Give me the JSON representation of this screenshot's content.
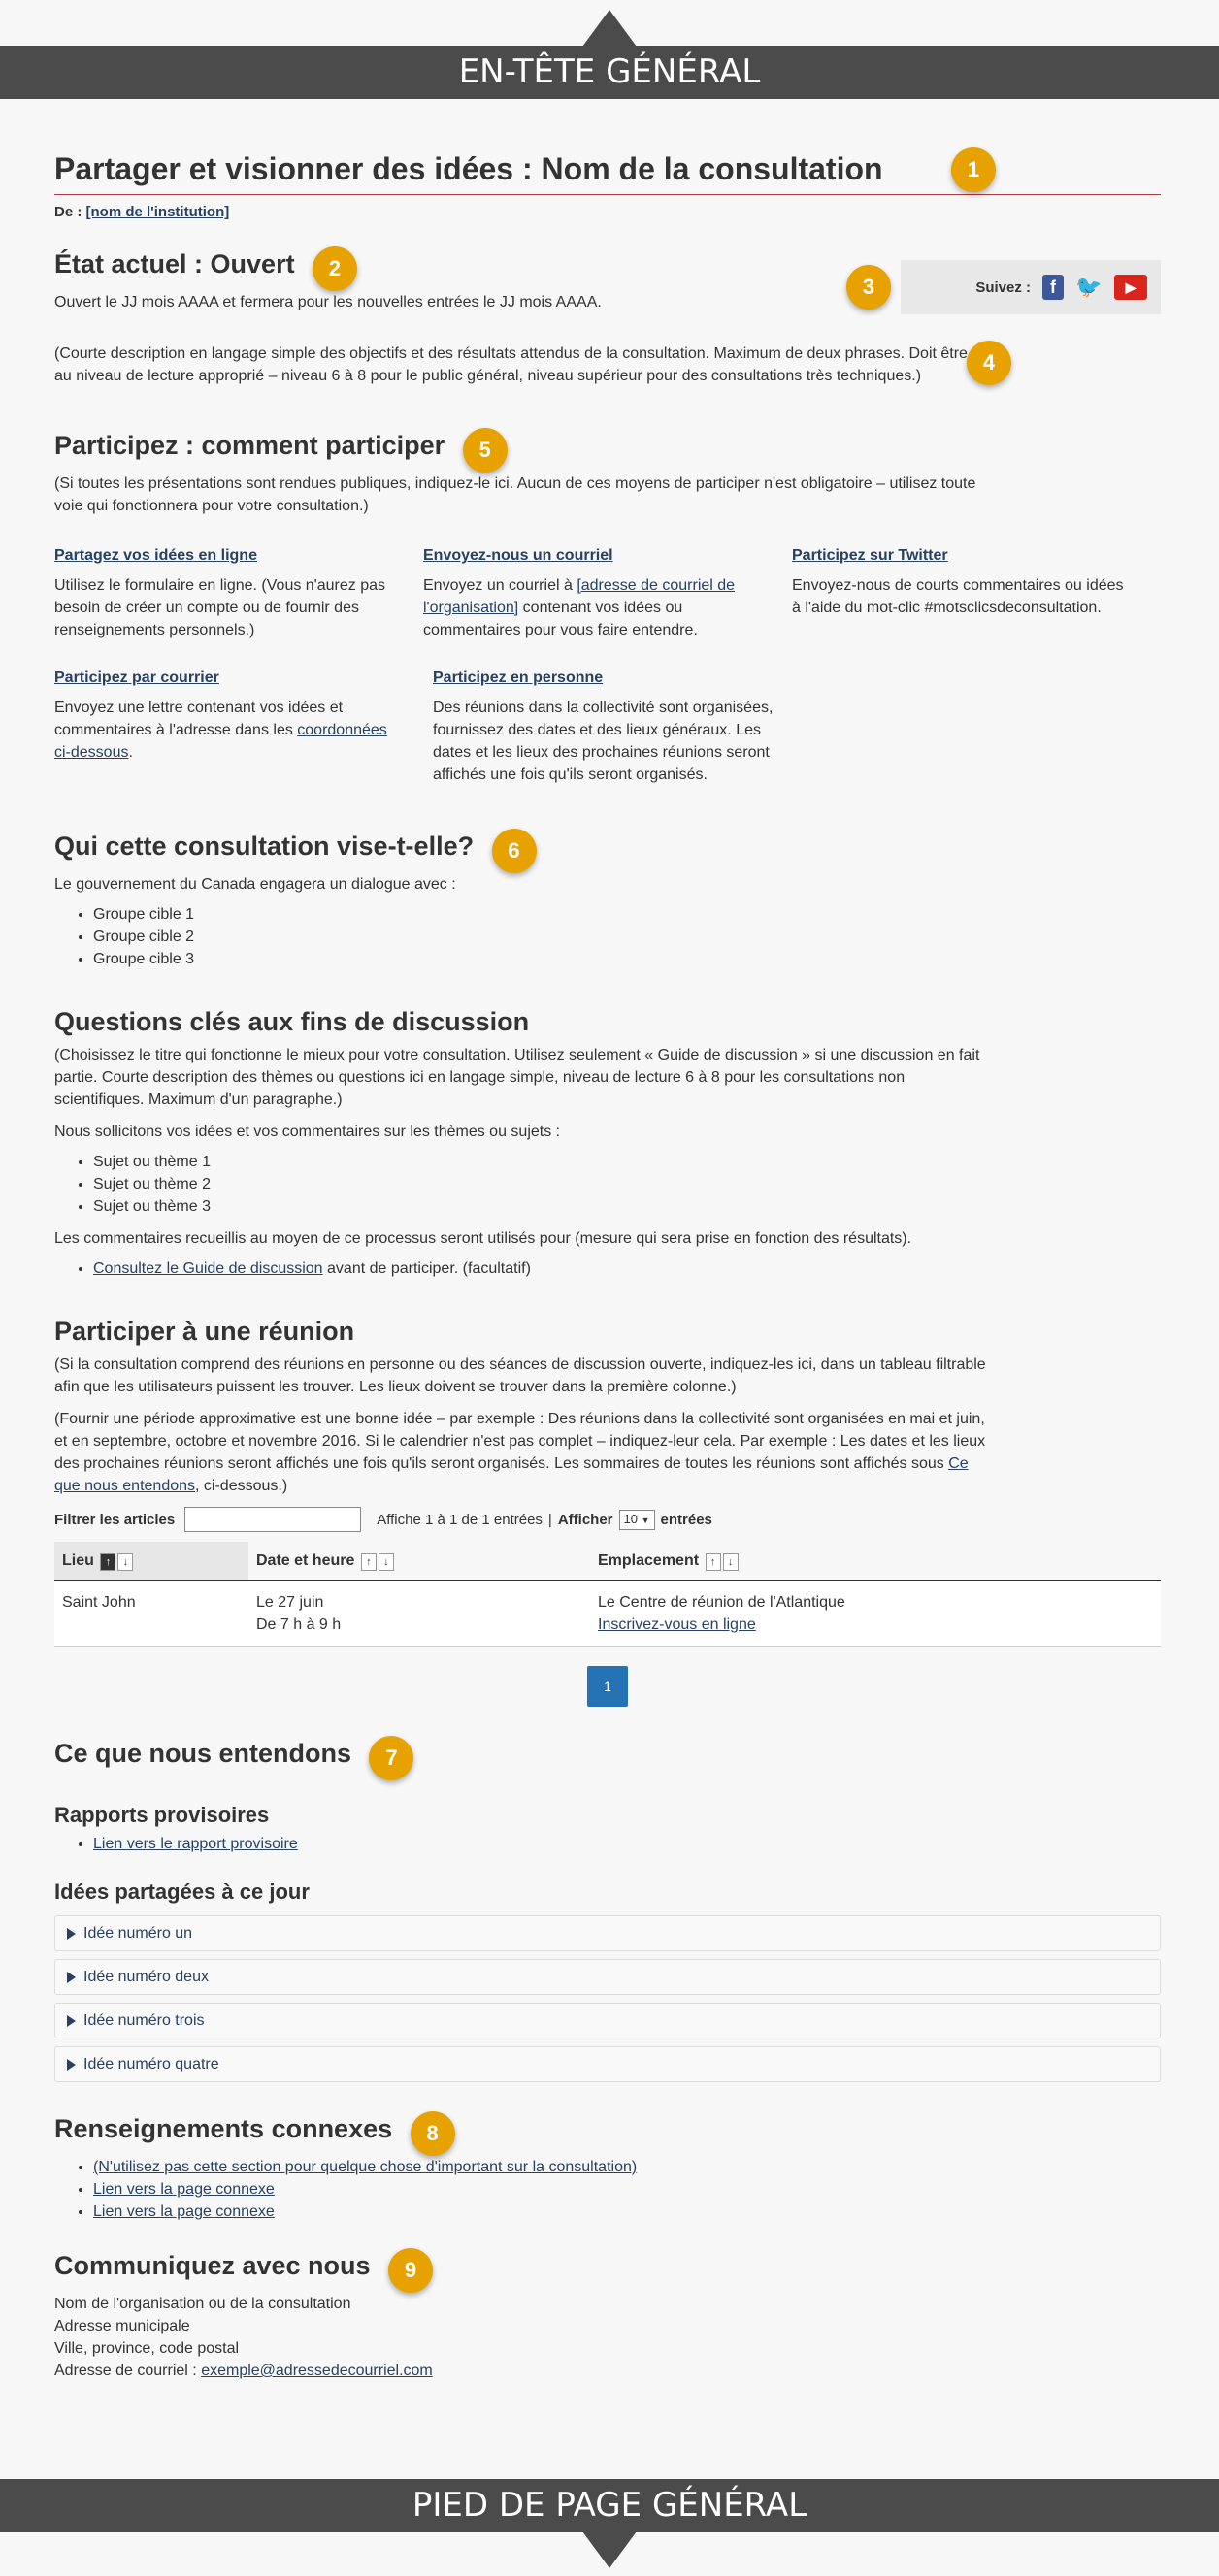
{
  "header_band": "EN-TÊTE GÉNÉRAL",
  "footer_band": "PIED DE PAGE GÉNÉRAL",
  "title": "Partager et visionner des idées : Nom de la consultation",
  "byline_prefix": "De : ",
  "byline_link": "[nom de l'institution]",
  "status": {
    "heading": "État actuel : Ouvert",
    "text": "Ouvert le JJ mois AAAA et fermera pour les nouvelles entrées le JJ mois AAAA."
  },
  "follow": {
    "label": "Suivez :",
    "icons": [
      "facebook-icon",
      "twitter-icon",
      "youtube-icon"
    ]
  },
  "description": "(Courte description en langage simple des objectifs et des résultats attendus de la consultation. Maximum de deux phrases. Doit être au niveau de lecture approprié – niveau 6 à 8 pour le public général, niveau supérieur pour des consultations très techniques.)",
  "participate": {
    "heading": "Participez : comment participer",
    "intro": "(Si toutes les présentations sont rendues publiques, indiquez-le ici. Aucun de ces moyens de participer n'est obligatoire – utilisez toute voie qui fonctionnera pour votre consultation.)",
    "online": {
      "title": "Partagez vos idées en ligne",
      "text": "Utilisez le formulaire en ligne. (Vous n'aurez pas besoin de créer un compte ou de fournir des renseignements personnels.)"
    },
    "email": {
      "title": "Envoyez-nous un courriel",
      "before": "Envoyez un courriel à ",
      "link": "[adresse de courriel de l'organisation]",
      "after": " contenant vos idées ou commentaires pour vous faire entendre."
    },
    "twitter": {
      "title": "Participez sur Twitter",
      "text": "Envoyez-nous de courts commentaires ou idées à l'aide du mot-clic #motsclicsdeconsultation."
    },
    "mail": {
      "title": "Participez par courrier",
      "before": "Envoyez une lettre contenant vos idées et commentaires à l'adresse dans les ",
      "link": "coordonnées ci-dessous",
      "after": "."
    },
    "inperson": {
      "title": "Participez en personne",
      "text": "Des réunions dans la collectivité sont organisées, fournissez des dates et des lieux généraux. Les dates et les lieux des prochaines réunions seront affichés une fois qu'ils seront organisés."
    }
  },
  "audience": {
    "heading": "Qui cette consultation vise-t-elle?",
    "intro": "Le gouvernement du Canada engagera un dialogue avec :",
    "items": [
      "Groupe cible 1",
      "Groupe cible 2",
      "Groupe cible 3"
    ]
  },
  "questions": {
    "heading": "Questions clés aux fins de discussion",
    "intro": "(Choisissez le titre qui fonctionne le mieux pour votre consultation. Utilisez seulement « Guide de discussion » si une discussion en fait partie. Courte description des thèmes ou questions ici en langage simple, niveau de lecture 6 à 8 pour les consultations non scientifiques. Maximum d'un paragraphe.)",
    "lead": "Nous sollicitons vos idées et vos commentaires sur les thèmes ou sujets :",
    "items": [
      "Sujet ou thème 1",
      "Sujet ou thème 2",
      "Sujet ou thème 3"
    ],
    "use": "Les commentaires recueillis au moyen de ce processus seront utilisés pour (mesure qui sera prise en fonction des résultats).",
    "guide_link": "Consultez le Guide de discussion",
    "guide_after": " avant de participer. (facultatif)"
  },
  "meeting": {
    "heading": "Participer à une réunion",
    "p1": "(Si la consultation comprend des réunions en personne ou des séances de discussion ouverte, indiquez-les ici, dans un tableau filtrable afin que les utilisateurs puissent les trouver. Les lieux doivent se trouver dans la première colonne.)",
    "p2_before": "(Fournir une période approximative est une bonne idée – par exemple : Des réunions dans la collectivité sont organisées en mai et juin, et en septembre, octobre et novembre 2016. Si le calendrier n'est pas complet – indiquez-leur cela. Par exemple : Les dates et les lieux des prochaines réunions seront affichés une fois qu'ils seront organisés. Les sommaires de toutes les réunions sont affichés sous ",
    "p2_link": "Ce que nous entendons",
    "p2_after": ", ci-dessous.)",
    "filter_label": "Filtrer les articles",
    "filter_value": "",
    "info": "Affiche 1 à 1 de 1 entrées",
    "show_label": "Afficher",
    "show_value": "10",
    "entries_label": "entrées",
    "columns": [
      "Lieu",
      "Date et heure",
      "Emplacement"
    ],
    "rows": [
      {
        "place": "Saint John",
        "date": "Le 27 juin",
        "time": "De 7 h à 9 h",
        "location": "Le Centre de réunion de l'Atlantique",
        "register": "Inscrivez-vous en ligne"
      }
    ],
    "page": "1"
  },
  "hearing": {
    "heading": "Ce que nous entendons",
    "interim_heading": "Rapports provisoires",
    "interim_link": "Lien vers le rapport provisoire",
    "ideas_heading": "Idées partagées à ce jour",
    "ideas": [
      "Idée numéro un",
      "Idée numéro deux",
      "Idée numéro trois",
      "Idée numéro quatre"
    ]
  },
  "related": {
    "heading": "Renseignements connexes",
    "items": [
      "(N'utilisez pas cette section pour quelque chose d'important sur la consultation)",
      "Lien vers la page connexe",
      "Lien vers la page connexe"
    ]
  },
  "contact": {
    "heading": "Communiquez avec nous",
    "lines": [
      "Nom de l'organisation ou de la consultation",
      "Adresse municipale",
      "Ville, province, code postal"
    ],
    "email_label": "Adresse de courriel : ",
    "email": "exemple@adressedecourriel.com"
  },
  "badges": [
    "1",
    "2",
    "3",
    "4",
    "5",
    "6",
    "7",
    "8",
    "9"
  ],
  "colors": {
    "badge": "#e8a200",
    "band": "#4b4b4b",
    "link": "#284162",
    "pager": "#2572b4",
    "rule": "#af3c43"
  }
}
